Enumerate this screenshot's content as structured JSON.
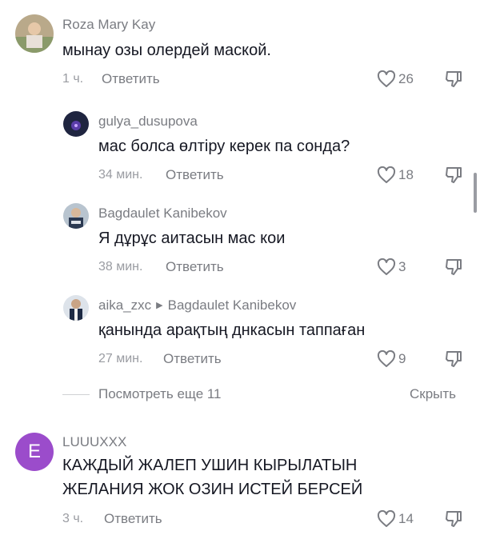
{
  "comments": [
    {
      "username": "Roza Mary Kay",
      "text": "мынау озы олердей маской.",
      "time": "1 ч.",
      "reply_label": "Ответить",
      "likes": "26"
    },
    {
      "username": "gulya_dusupova",
      "text": "мас болса өлтіру керек па сонда?",
      "time": "34 мин.",
      "reply_label": "Ответить",
      "likes": "18"
    },
    {
      "username": "Bagdaulet Kanibekov",
      "text": "Я дұрұс аитасын мас кои",
      "time": "38 мин.",
      "reply_label": "Ответить",
      "likes": "3"
    },
    {
      "username": "aika_zxc",
      "reply_to": "Bagdaulet Kanibekov",
      "text": "қанында арақтың днкасын таппаған",
      "time": "27 мин.",
      "reply_label": "Ответить",
      "likes": "9"
    },
    {
      "username": "LUUUXXX",
      "avatar_letter": "E",
      "text_line1": "КАЖДЫЙ ЖАЛЕП УШИН КЫРЫЛАТЫН",
      "text_line2": "ЖЕЛАНИЯ ЖОК ОЗИН ИСТЕЙ БЕРСЕЙ",
      "time": "3 ч.",
      "reply_label": "Ответить",
      "likes": "14"
    }
  ],
  "thread": {
    "view_more": "Посмотреть еще 11",
    "hide": "Скрыть"
  },
  "icons": {
    "like": "heart-outline-icon",
    "dislike": "thumbs-down-icon"
  },
  "colors": {
    "text": "#161823",
    "muted": "#7a7c82",
    "letter_avatar_bg": "#9b4ccb"
  }
}
